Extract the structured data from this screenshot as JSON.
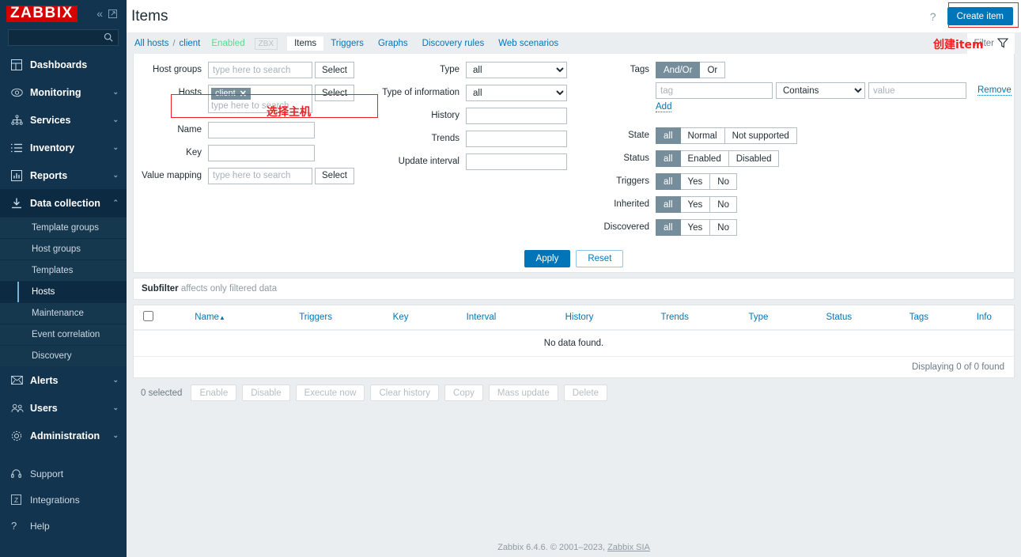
{
  "sidebar": {
    "logo": "ZABBIX",
    "collapse_icon": "chevron-double-left-icon",
    "pin_icon": "pin-window-icon",
    "search_placeholder": "",
    "search_icon": "search-icon",
    "items": [
      {
        "label": "Dashboards",
        "icon": "dashboard-icon",
        "caret": ""
      },
      {
        "label": "Monitoring",
        "icon": "eye-icon",
        "caret": "⌄"
      },
      {
        "label": "Services",
        "icon": "services-tree-icon",
        "caret": "⌄"
      },
      {
        "label": "Inventory",
        "icon": "list-icon",
        "caret": "⌄"
      },
      {
        "label": "Reports",
        "icon": "report-chart-icon",
        "caret": "⌄"
      },
      {
        "label": "Data collection",
        "icon": "download-icon",
        "caret": "⌃"
      }
    ],
    "data_collection_sub": [
      "Template groups",
      "Host groups",
      "Templates",
      "Hosts",
      "Maintenance",
      "Event correlation",
      "Discovery"
    ],
    "data_collection_selected": "Hosts",
    "items_after": [
      {
        "label": "Alerts",
        "icon": "envelope-icon",
        "caret": "⌄"
      },
      {
        "label": "Users",
        "icon": "users-icon",
        "caret": "⌄"
      },
      {
        "label": "Administration",
        "icon": "gear-icon",
        "caret": "⌄"
      }
    ],
    "footer_items": [
      {
        "label": "Support",
        "icon": "headset-icon"
      },
      {
        "label": "Integrations",
        "icon": "zabbix-square-icon"
      },
      {
        "label": "Help",
        "icon": "question-icon"
      }
    ]
  },
  "header": {
    "title": "Items",
    "help_icon": "question-mark-icon",
    "create_button": "Create item"
  },
  "breadcrumb": {
    "all_hosts": "All hosts",
    "separator": "/",
    "host": "client",
    "status": "Enabled",
    "agent_badge": "ZBX",
    "tabs": [
      {
        "label": "Items",
        "current": true
      },
      {
        "label": "Triggers",
        "current": false
      },
      {
        "label": "Graphs",
        "current": false
      },
      {
        "label": "Discovery rules",
        "current": false
      },
      {
        "label": "Web scenarios",
        "current": false
      }
    ],
    "filter_tab_label": "Filter",
    "filter_tab_icon": "funnel-icon"
  },
  "filter": {
    "host_groups": {
      "label": "Host groups",
      "placeholder": "type here to search",
      "value": "",
      "select_button": "Select"
    },
    "hosts": {
      "label": "Hosts",
      "chip": "client",
      "chip_remove_icon": "close-x-icon",
      "placeholder": "type here to search",
      "select_button": "Select"
    },
    "name": {
      "label": "Name",
      "value": ""
    },
    "key": {
      "label": "Key",
      "value": ""
    },
    "value_mapping": {
      "label": "Value mapping",
      "placeholder": "type here to search",
      "value": "",
      "select_button": "Select"
    },
    "type": {
      "label": "Type",
      "value": "all",
      "options": [
        "all"
      ]
    },
    "type_of_information": {
      "label": "Type of information",
      "value": "all",
      "options": [
        "all"
      ]
    },
    "history": {
      "label": "History",
      "value": ""
    },
    "trends": {
      "label": "Trends",
      "value": ""
    },
    "update_interval": {
      "label": "Update interval",
      "value": ""
    },
    "tags": {
      "label": "Tags",
      "operator_options": [
        "And/Or",
        "Or"
      ],
      "operator_selected": "And/Or",
      "tag_placeholder": "tag",
      "tag_value": "",
      "condition_value": "Contains",
      "condition_options": [
        "Contains"
      ],
      "value_placeholder": "value",
      "value_value": "",
      "remove_label": "Remove",
      "add_label": "Add"
    },
    "state": {
      "label": "State",
      "options": [
        "all",
        "Normal",
        "Not supported"
      ],
      "selected": "all"
    },
    "status": {
      "label": "Status",
      "options": [
        "all",
        "Enabled",
        "Disabled"
      ],
      "selected": "all"
    },
    "triggers": {
      "label": "Triggers",
      "options": [
        "all",
        "Yes",
        "No"
      ],
      "selected": "all"
    },
    "inherited": {
      "label": "Inherited",
      "options": [
        "all",
        "Yes",
        "No"
      ],
      "selected": "all"
    },
    "discovered": {
      "label": "Discovered",
      "options": [
        "all",
        "Yes",
        "No"
      ],
      "selected": "all"
    },
    "apply_button": "Apply",
    "reset_button": "Reset"
  },
  "subfilter": {
    "title": "Subfilter",
    "hint": "affects only filtered data"
  },
  "table": {
    "columns": [
      "Name",
      "Triggers",
      "Key",
      "Interval",
      "History",
      "Trends",
      "Type",
      "Status",
      "Tags",
      "Info"
    ],
    "sorted_column": "Name",
    "sort_arrow": "▲",
    "no_data": "No data found.",
    "displaying": "Displaying 0 of 0 found"
  },
  "actions": {
    "selected_count": "0 selected",
    "buttons": [
      "Enable",
      "Disable",
      "Execute now",
      "Clear history",
      "Copy",
      "Mass update",
      "Delete"
    ]
  },
  "footer": {
    "text": "Zabbix 6.4.6. © 2001–2023, ",
    "link": "Zabbix SIA"
  },
  "annotations": {
    "create_item_cn": "创建item",
    "select_host_cn": "选择主机",
    "color": "#ee2222"
  }
}
